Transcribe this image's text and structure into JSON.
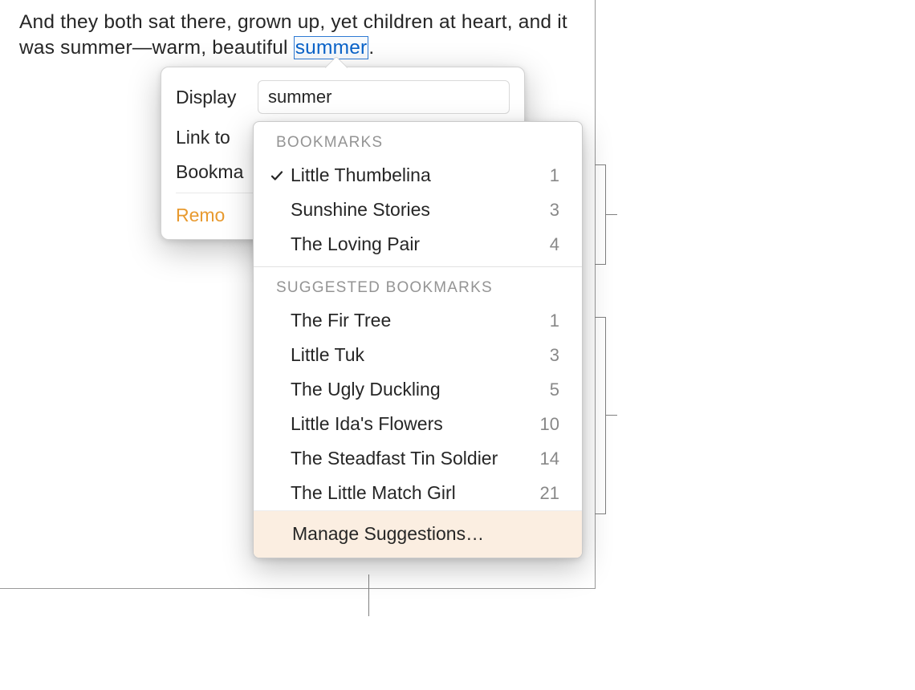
{
  "document": {
    "text_before": "And they both sat there, grown up, yet children at heart, and it was summer—warm, beautiful ",
    "highlighted": "summer",
    "text_after": "."
  },
  "popover": {
    "display_label": "Display",
    "display_value": "summer",
    "link_to_label": "Link to",
    "bookmark_label_truncated": "Bookma",
    "remove_label_truncated": "Remo"
  },
  "dropdown": {
    "bookmarks_header": "BOOKMARKS",
    "bookmarks": [
      {
        "label": "Little Thumbelina",
        "count": "1",
        "checked": true
      },
      {
        "label": "Sunshine Stories",
        "count": "3",
        "checked": false
      },
      {
        "label": "The Loving Pair",
        "count": "4",
        "checked": false
      }
    ],
    "suggested_header": "SUGGESTED BOOKMARKS",
    "suggested": [
      {
        "label": "The Fir Tree",
        "count": "1"
      },
      {
        "label": "Little Tuk",
        "count": "3"
      },
      {
        "label": "The Ugly Duckling",
        "count": "5"
      },
      {
        "label": "Little Ida's Flowers",
        "count": "10"
      },
      {
        "label": "The Steadfast Tin Soldier",
        "count": "14"
      },
      {
        "label": "The Little Match Girl",
        "count": "21"
      }
    ],
    "manage_label": "Manage Suggestions…"
  }
}
